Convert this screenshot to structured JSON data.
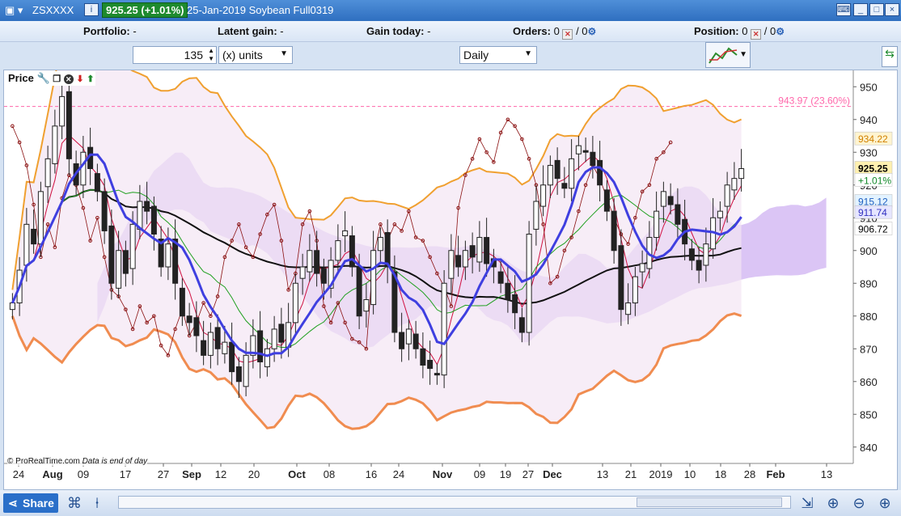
{
  "title_bar": {
    "symbol": "ZSXXXX",
    "info_label": "i",
    "price_badge": "925.25 (+1.01%)",
    "date_product": "25-Jan-2019 Soybean Full0319"
  },
  "status_bar": {
    "portfolio_label": "Portfolio:",
    "portfolio_value": "-",
    "latent_label": "Latent gain:",
    "latent_value": "-",
    "gain_today_label": "Gain today:",
    "gain_today_value": "-",
    "orders_label": "Orders:",
    "orders_a": "0",
    "orders_b": "/ 0",
    "position_label": "Position:",
    "position_a": "0",
    "position_b": "/ 0"
  },
  "toolbar": {
    "units_value": "135",
    "units_label": "(x) units",
    "period_value": "Daily"
  },
  "panel": {
    "label": "Price",
    "watermark": "© ProRealTime.com",
    "note": "Data is end of day"
  },
  "bottom_bar": {
    "share_label": "Share"
  },
  "colors": {
    "ma_line": "#3f3fe0",
    "cloud_purple": "#b07ee8",
    "bollinger": "#f0a030",
    "ref_line": "#ff66aa"
  },
  "chart_data": {
    "type": "candlestick",
    "y_range": [
      835,
      955
    ],
    "y_ticks": [
      840,
      850,
      860,
      870,
      880,
      890,
      900,
      910,
      920,
      930,
      940,
      950
    ],
    "x_labels": [
      "24",
      "Aug",
      "09",
      "17",
      "27",
      "Sep",
      "12",
      "20",
      "Oct",
      "08",
      "16",
      "24",
      "Nov",
      "09",
      "19",
      "27",
      "Dec",
      "13",
      "21",
      "2019",
      "10",
      "18",
      "28",
      "Feb",
      "13"
    ],
    "price_labels": [
      {
        "text": "934.22",
        "value": 934.22,
        "bg": "#fff4d0",
        "fg": "#d08000"
      },
      {
        "text": "925.25",
        "value": 925.25,
        "bg": "#fff0b0",
        "fg": "#000"
      },
      {
        "text": "+1.01%",
        "value": 921.6,
        "bg": "#ffffff",
        "fg": "#138a2a"
      },
      {
        "text": "915.12",
        "value": 915.12,
        "bg": "#e3f3ff",
        "fg": "#1f5fc0"
      },
      {
        "text": "911.74",
        "value": 911.74,
        "bg": "#e6e6ff",
        "fg": "#3030c0"
      },
      {
        "text": "906.72",
        "value": 906.72,
        "bg": "#ffffff",
        "fg": "#000"
      }
    ],
    "ref_line": {
      "value": 943.97,
      "label": "943.97 (23.60%)"
    },
    "candle_closes": [
      884,
      894,
      908,
      902,
      918,
      928,
      938,
      947,
      928,
      920,
      930,
      925,
      918,
      906,
      890,
      900,
      893,
      908,
      915,
      912,
      905,
      895,
      902,
      890,
      880,
      878,
      874,
      868,
      875,
      870,
      872,
      863,
      860,
      868,
      874,
      866,
      870,
      876,
      872,
      878,
      890,
      895,
      900,
      893,
      890,
      897,
      903,
      906,
      895,
      880,
      885,
      900,
      904,
      895,
      875,
      870,
      876,
      870,
      865,
      864,
      862,
      890,
      900,
      895,
      900,
      898,
      904,
      896,
      895,
      890,
      885,
      881,
      875,
      905,
      915,
      920,
      926,
      922,
      919,
      928,
      932,
      930,
      926,
      920,
      912,
      900,
      882,
      884,
      892,
      896,
      904,
      912,
      918,
      914,
      908,
      902,
      897,
      894,
      902,
      910,
      912,
      920,
      922,
      925
    ]
  }
}
